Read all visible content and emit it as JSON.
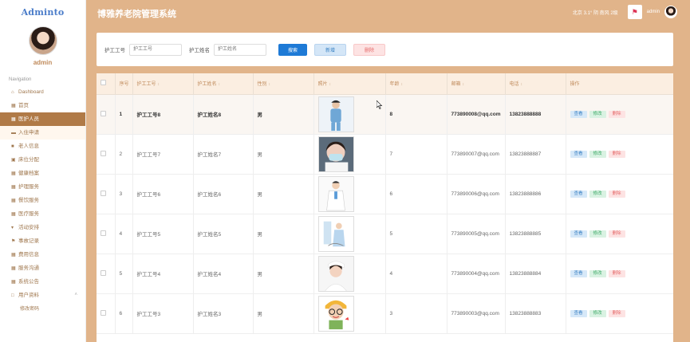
{
  "logo": "Adminto",
  "sidebar": {
    "username": "admin",
    "nav_heading": "Navigation",
    "items": [
      {
        "label": "Dashboard",
        "icon": "home-icon"
      },
      {
        "label": "首页",
        "icon": "grid-icon"
      },
      {
        "label": "医护人员",
        "icon": "grid-icon",
        "active": true
      },
      {
        "label": "入住申请",
        "icon": "chat-icon"
      },
      {
        "label": "老人信息",
        "icon": "user-icon"
      },
      {
        "label": "床位分配",
        "icon": "bed-icon"
      },
      {
        "label": "健康档案",
        "icon": "grid-icon"
      },
      {
        "label": "护理服务",
        "icon": "grid-icon"
      },
      {
        "label": "餐饮服务",
        "icon": "grid-icon"
      },
      {
        "label": "医疗服务",
        "icon": "grid-icon"
      },
      {
        "label": "活动安排",
        "icon": "pin-icon"
      },
      {
        "label": "事故记录",
        "icon": "flag-icon"
      },
      {
        "label": "费用信息",
        "icon": "grid-icon"
      },
      {
        "label": "服务沟通",
        "icon": "grid-icon"
      },
      {
        "label": "系统公告",
        "icon": "grid-icon"
      },
      {
        "label": "用户资料",
        "icon": "calendar-icon"
      }
    ],
    "sub_item": "修改密码"
  },
  "header": {
    "title": "博雅养老院管理系统",
    "weather": "北京  3.1°  阴  南风  2级",
    "user": "admin"
  },
  "search": {
    "label_id": "护工工号",
    "placeholder_id": "护工工号",
    "label_name": "护工姓名",
    "placeholder_name": "护工姓名",
    "btn_search": "搜索",
    "btn_add": "新增",
    "btn_delete": "删除"
  },
  "table": {
    "headers": [
      "序号",
      "护工工号",
      "护工姓名",
      "性别",
      "照片",
      "年龄",
      "邮箱",
      "电话",
      "操作"
    ],
    "actions": {
      "view": "查看",
      "edit": "修改",
      "delete": "删除"
    },
    "rows": [
      {
        "no": "1",
        "id": "护工工号8",
        "name": "护工姓名8",
        "gender": "男",
        "age": "8",
        "email": "773890008@qq.com",
        "phone": "13823888888"
      },
      {
        "no": "2",
        "id": "护工工号7",
        "name": "护工姓名7",
        "gender": "男",
        "age": "7",
        "email": "773890007@qq.com",
        "phone": "13823888887"
      },
      {
        "no": "3",
        "id": "护工工号6",
        "name": "护工姓名6",
        "gender": "男",
        "age": "6",
        "email": "773890006@qq.com",
        "phone": "13823888886"
      },
      {
        "no": "4",
        "id": "护工工号5",
        "name": "护工姓名5",
        "gender": "男",
        "age": "5",
        "email": "773890005@qq.com",
        "phone": "13823888885"
      },
      {
        "no": "5",
        "id": "护工工号4",
        "name": "护工姓名4",
        "gender": "男",
        "age": "4",
        "email": "773890004@qq.com",
        "phone": "13823888884"
      },
      {
        "no": "6",
        "id": "护工工号3",
        "name": "护工姓名3",
        "gender": "男",
        "age": "3",
        "email": "773890003@qq.com",
        "phone": "13823888883"
      }
    ]
  },
  "colors": {
    "accent": "#e1b48a",
    "active_nav": "#b07a47",
    "primary_btn": "#1e7ad6"
  }
}
